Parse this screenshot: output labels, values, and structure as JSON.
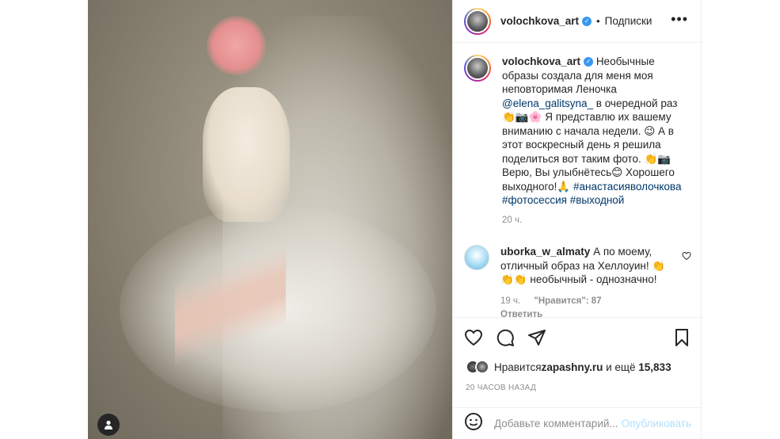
{
  "post": {
    "username": "volochkova_art",
    "follow_label": "Подписки",
    "more_label": "•••",
    "caption_username": "volochkova_art",
    "caption_line1": "Необычные образы создала для меня моя неповторимая Леночка",
    "caption_mention": "@elena_galitsyna_",
    "caption_line2": " в очередной раз",
    "caption_emoji1": "👏📷🌸",
    "caption_line3": " Я представлю их вашему вниманию с начала недели. 😉 А в этот воскресный день я решила поделиться вот таким фото. 👏📷 Верю, Вы улыбнётесь😊 Хорошего выходного!🙏 ",
    "caption_hashtag1": "#анастасияволочкова",
    "caption_hashtag2": "#фотосессия",
    "caption_hashtag3": "#выходной",
    "caption_time": "20 ч."
  },
  "comment": {
    "username": "uborka_w_almaty",
    "text": " А по моему, отличный образ на Хеллоуин! 👏 👏👏 необычный - однозначно!",
    "time": "19 ч.",
    "likes": "\"Нравится\": 87",
    "reply": "Ответить"
  },
  "likes": {
    "prefix": "Нравится ",
    "user": "zapashny.ru",
    "suffix": " и ещё ",
    "count": "15,833"
  },
  "date": "20 ЧАСОВ НАЗАД",
  "add_comment": {
    "placeholder": "Добавьте комментарий...",
    "post_label": "Опубликовать"
  },
  "icons": {
    "like": "heart-icon",
    "comment": "comment-icon",
    "share": "share-icon",
    "save": "bookmark-icon",
    "emoji": "emoji-icon",
    "user_tag": "user-tag-icon"
  },
  "colors": {
    "link": "#00376b",
    "verified": "#3897f0",
    "muted": "#8e8e8e",
    "post_button": "#b2dffc"
  }
}
